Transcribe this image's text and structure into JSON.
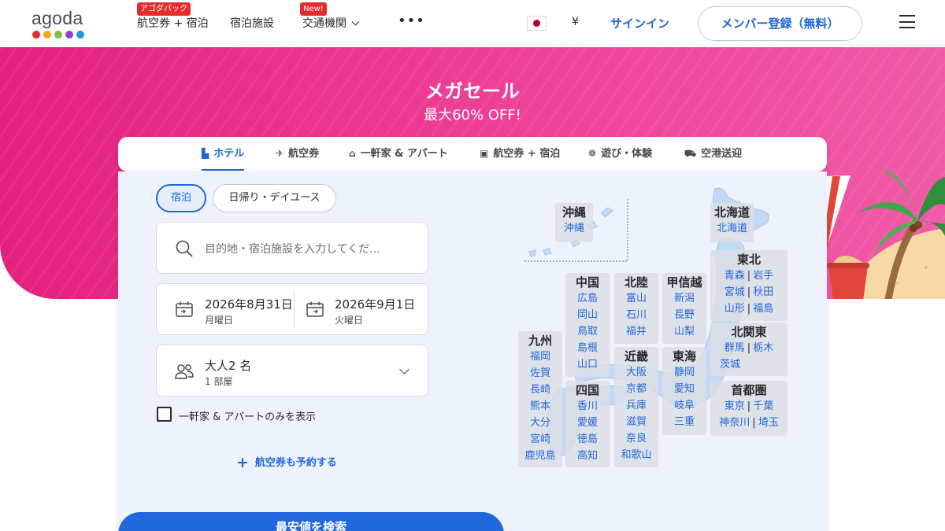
{
  "header": {
    "logo_text": "agoda",
    "logo_dot_colors": [
      "#e12d2d",
      "#f8a41e",
      "#7cc04b",
      "#9f3bc9",
      "#1e9ad6"
    ],
    "nav": [
      {
        "label": "航空券 + 宿泊",
        "badge": "アゴダパック"
      },
      {
        "label": "宿泊施設",
        "badge": ""
      },
      {
        "label": "交通機関",
        "badge": "New!"
      }
    ],
    "more": "•••",
    "currency": "¥",
    "signin": "サインイン",
    "register": "メンバー登録（無料）"
  },
  "hero": {
    "title": "メガセール",
    "subtitle": "最大60% OFF!"
  },
  "tabs": [
    {
      "label": "ホテル",
      "icon": "hotel-icon",
      "active": true
    },
    {
      "label": "航空券",
      "icon": "plane-icon",
      "active": false
    },
    {
      "label": "一軒家 & アパート",
      "icon": "house-icon",
      "active": false
    },
    {
      "label": "航空券 + 宿泊",
      "icon": "package-icon",
      "active": false
    },
    {
      "label": "遊び・体験",
      "icon": "activity-icon",
      "active": false
    },
    {
      "label": "空港送迎",
      "icon": "car-icon",
      "active": false
    }
  ],
  "stay_type": {
    "overnight": "宿泊",
    "day_use": "日帰り・デイユース"
  },
  "search": {
    "placeholder": "目的地・宿泊施設を入力してくだ..."
  },
  "dates": {
    "checkin_date": "2026年8月31日",
    "checkin_day": "月曜日",
    "checkout_date": "2026年9月1日",
    "checkout_day": "火曜日"
  },
  "guests": {
    "main": "大人2 名",
    "sub": "1 部屋"
  },
  "options": {
    "homes_only": "一軒家 & アパートのみを表示"
  },
  "add_flight": "航空券も予約する",
  "search_button": "最安値を検索",
  "map": {
    "okinawa": {
      "name": "沖縄",
      "prefs": [
        "沖縄"
      ]
    },
    "hokkaido": {
      "name": "北海道",
      "prefs": [
        "北海道"
      ]
    },
    "tohoku": {
      "name": "東北",
      "rows": [
        [
          "青森",
          "岩手"
        ],
        [
          "宮城",
          "秋田"
        ],
        [
          "山形",
          "福島"
        ]
      ]
    },
    "chugoku": {
      "name": "中国",
      "prefs": [
        "広島",
        "岡山",
        "鳥取",
        "島根",
        "山口"
      ]
    },
    "hokuriku": {
      "name": "北陸",
      "prefs": [
        "富山",
        "石川",
        "福井"
      ]
    },
    "koshinetsu": {
      "name": "甲信越",
      "prefs": [
        "新潟",
        "長野",
        "山梨"
      ]
    },
    "kitakanto": {
      "name": "北関東",
      "rows": [
        [
          "群馬",
          "栃木"
        ],
        [
          "茨城"
        ]
      ]
    },
    "kyushu": {
      "name": "九州",
      "prefs": [
        "福岡",
        "佐賀",
        "長崎",
        "熊本",
        "大分",
        "宮崎",
        "鹿児島"
      ]
    },
    "kinki": {
      "name": "近畿",
      "prefs": [
        "大阪",
        "京都",
        "兵庫",
        "滋賀",
        "奈良",
        "和歌山"
      ]
    },
    "tokai": {
      "name": "東海",
      "prefs": [
        "静岡",
        "愛知",
        "岐阜",
        "三重"
      ]
    },
    "shikoku": {
      "name": "四国",
      "prefs": [
        "香川",
        "愛媛",
        "徳島",
        "高知"
      ]
    },
    "shutoken": {
      "name": "首都圏",
      "rows": [
        [
          "東京",
          "千葉"
        ],
        [
          "神奈川",
          "埼玉"
        ]
      ]
    }
  }
}
